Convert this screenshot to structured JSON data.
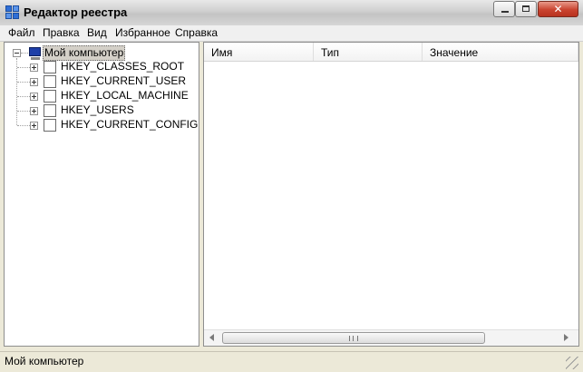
{
  "window": {
    "title": "Редактор реестра",
    "icon": "registry-editor-icon",
    "controls": {
      "minimize_icon": "minimize-icon",
      "maximize_icon": "maximize-icon",
      "close_icon": "close-icon",
      "close_glyph": "✕"
    }
  },
  "menu": {
    "items": [
      {
        "label": "Файл"
      },
      {
        "label": "Правка"
      },
      {
        "label": "Вид"
      },
      {
        "label": "Избранное"
      },
      {
        "label": "Справка"
      }
    ]
  },
  "tree": {
    "root": {
      "label": "Мой компьютер",
      "icon": "computer-icon",
      "expanded": true,
      "selected": true
    },
    "children": [
      {
        "label": "HKEY_CLASSES_ROOT",
        "icon": "folder-icon"
      },
      {
        "label": "HKEY_CURRENT_USER",
        "icon": "folder-icon"
      },
      {
        "label": "HKEY_LOCAL_MACHINE",
        "icon": "folder-icon"
      },
      {
        "label": "HKEY_USERS",
        "icon": "folder-icon"
      },
      {
        "label": "HKEY_CURRENT_CONFIG",
        "icon": "folder-icon"
      }
    ]
  },
  "list": {
    "columns": [
      {
        "label": "Имя"
      },
      {
        "label": "Тип"
      },
      {
        "label": "Значение"
      }
    ],
    "rows": []
  },
  "statusbar": {
    "text": "Мой компьютер"
  },
  "colors": {
    "selection": "#d4d0c8",
    "pane_border": "#8e8e8e",
    "close_button": "#c9432f",
    "window_bg": "#ece9d8"
  }
}
